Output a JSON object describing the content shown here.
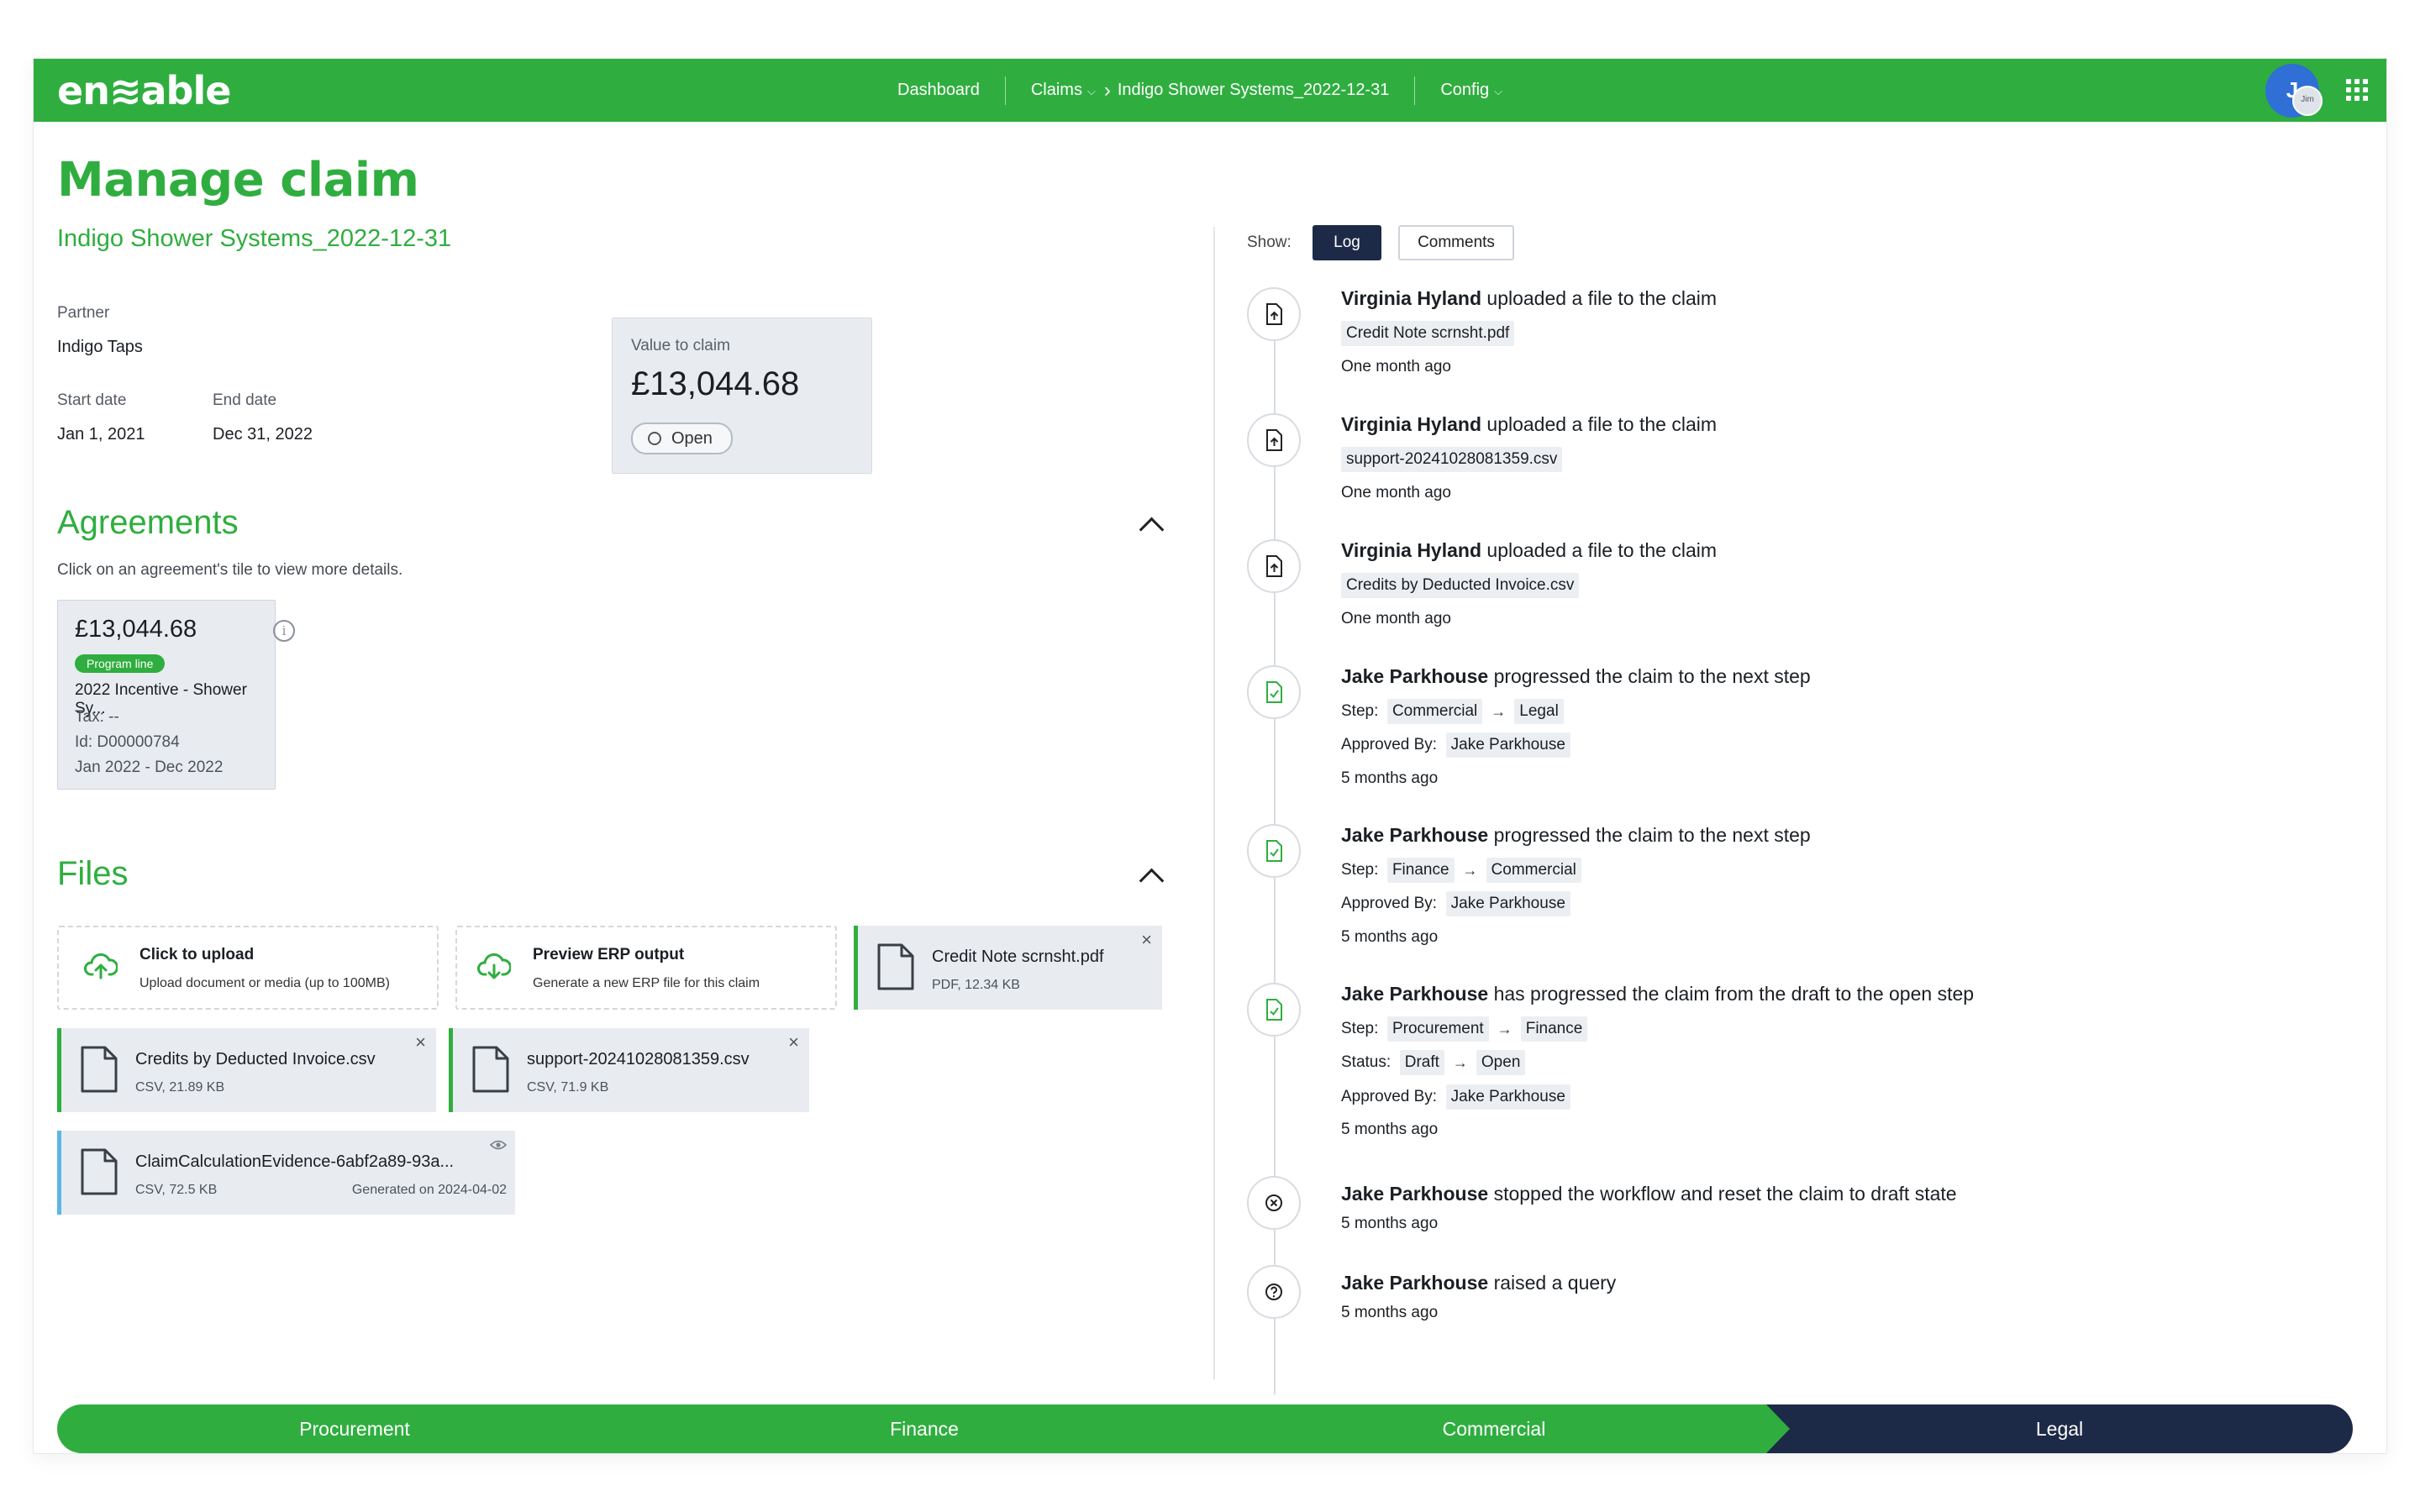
{
  "app": {
    "logo": "en≋able"
  },
  "nav": {
    "dashboard": "Dashboard",
    "claims": "Claims",
    "claim_crumb": "Indigo Shower Systems_2022-12-31",
    "config": "Config"
  },
  "user": {
    "avatar_initial": "J",
    "avatar_mini": "Jim"
  },
  "claim": {
    "page_title": "Manage claim",
    "name": "Indigo Shower Systems_2022-12-31",
    "partner_label": "Partner",
    "partner": "Indigo Taps",
    "start_label": "Start date",
    "start": "Jan 1, 2021",
    "end_label": "End date",
    "end": "Dec 31, 2022",
    "value_label": "Value to claim",
    "value": "£13,044.68",
    "status": "Open"
  },
  "agreements": {
    "title": "Agreements",
    "hint": "Click on an agreement's tile to view more details.",
    "tile": {
      "amount": "£13,044.68",
      "badge": "Program line",
      "name": "2022 Incentive - Shower Sy...",
      "tax": "Tax: --",
      "id": "Id: D00000784",
      "period": "Jan 2022 - Dec 2022"
    }
  },
  "files": {
    "title": "Files",
    "upload": {
      "title": "Click to upload",
      "subtitle": "Upload document or media (up to 100MB)"
    },
    "preview": {
      "title": "Preview ERP output",
      "subtitle": "Generate a new ERP file for this claim"
    },
    "items": [
      {
        "name": "Credit Note scrnsht.pdf",
        "meta": "PDF, 12.34 KB"
      },
      {
        "name": "Credits by Deducted Invoice.csv",
        "meta": "CSV, 21.89 KB"
      },
      {
        "name": "support-20241028081359.csv",
        "meta": "CSV, 71.9 KB"
      },
      {
        "name": "ClaimCalculationEvidence-6abf2a89-93a...",
        "meta": "CSV, 72.5 KB",
        "generated": "Generated on 2024-04-02"
      }
    ]
  },
  "log": {
    "show_label": "Show:",
    "log_btn": "Log",
    "comments_btn": "Comments",
    "step_label": "Step:",
    "approved_label": "Approved By:",
    "status_label": "Status:",
    "entries": [
      {
        "actor": "Virginia Hyland",
        "action": "uploaded a file to the claim",
        "chip": "Credit Note scrnsht.pdf",
        "time": "One month ago"
      },
      {
        "actor": "Virginia Hyland",
        "action": "uploaded a file to the claim",
        "chip": "support-20241028081359.csv",
        "time": "One month ago"
      },
      {
        "actor": "Virginia Hyland",
        "action": "uploaded a file to the claim",
        "chip": "Credits by Deducted Invoice.csv",
        "time": "One month ago"
      },
      {
        "actor": "Jake Parkhouse",
        "action": "progressed the claim to the next step",
        "step_from": "Commercial",
        "step_to": "Legal",
        "approved": "Jake Parkhouse",
        "time": "5 months ago"
      },
      {
        "actor": "Jake Parkhouse",
        "action": "progressed the claim to the next step",
        "step_from": "Finance",
        "step_to": "Commercial",
        "approved": "Jake Parkhouse",
        "time": "5 months ago"
      },
      {
        "actor": "Jake Parkhouse",
        "action": "has progressed the claim from the draft to the open step",
        "step_from": "Procurement",
        "step_to": "Finance",
        "status_from": "Draft",
        "status_to": "Open",
        "approved": "Jake Parkhouse",
        "time": "5 months ago"
      },
      {
        "actor": "Jake Parkhouse",
        "action": "stopped the workflow and reset the claim to draft state",
        "time": "5 months ago"
      },
      {
        "actor": "Jake Parkhouse",
        "action": "raised a query",
        "time": "5 months ago"
      }
    ]
  },
  "workflow": {
    "steps": [
      "Procurement",
      "Finance",
      "Commercial",
      "Legal"
    ],
    "current": "Legal"
  },
  "colors": {
    "brand_green": "#2fae3f",
    "navy": "#1d2a47",
    "tile_bg": "#e8ecf1",
    "file_blue": "#5ab7e6"
  }
}
